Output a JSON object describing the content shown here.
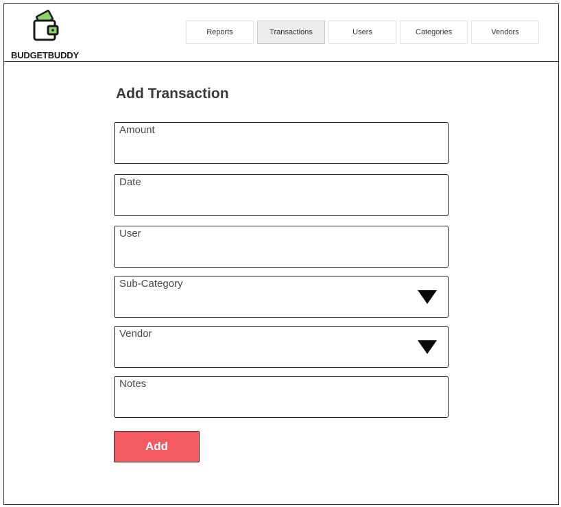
{
  "brand": {
    "name": "BUDGETBUDDY",
    "logo_icon": "wallet-icon"
  },
  "nav": {
    "tabs": [
      {
        "label": "Reports",
        "active": false
      },
      {
        "label": "Transactions",
        "active": true
      },
      {
        "label": "Users",
        "active": false
      },
      {
        "label": "Categories",
        "active": false
      },
      {
        "label": "Vendors",
        "active": false
      }
    ]
  },
  "form": {
    "title": "Add Transaction",
    "fields": {
      "amount": {
        "label": "Amount"
      },
      "date": {
        "label": "Date"
      },
      "user": {
        "label": "User"
      },
      "sub_category": {
        "label": "Sub-Category",
        "icon": "triangle-down-icon"
      },
      "vendor": {
        "label": "Vendor",
        "icon": "triangle-down-icon"
      },
      "notes": {
        "label": "Notes"
      }
    },
    "submit_label": "Add"
  },
  "colors": {
    "accent_button": "#f45a62",
    "active_tab_bg": "#ececef",
    "logo_green": "#8fd36f"
  }
}
